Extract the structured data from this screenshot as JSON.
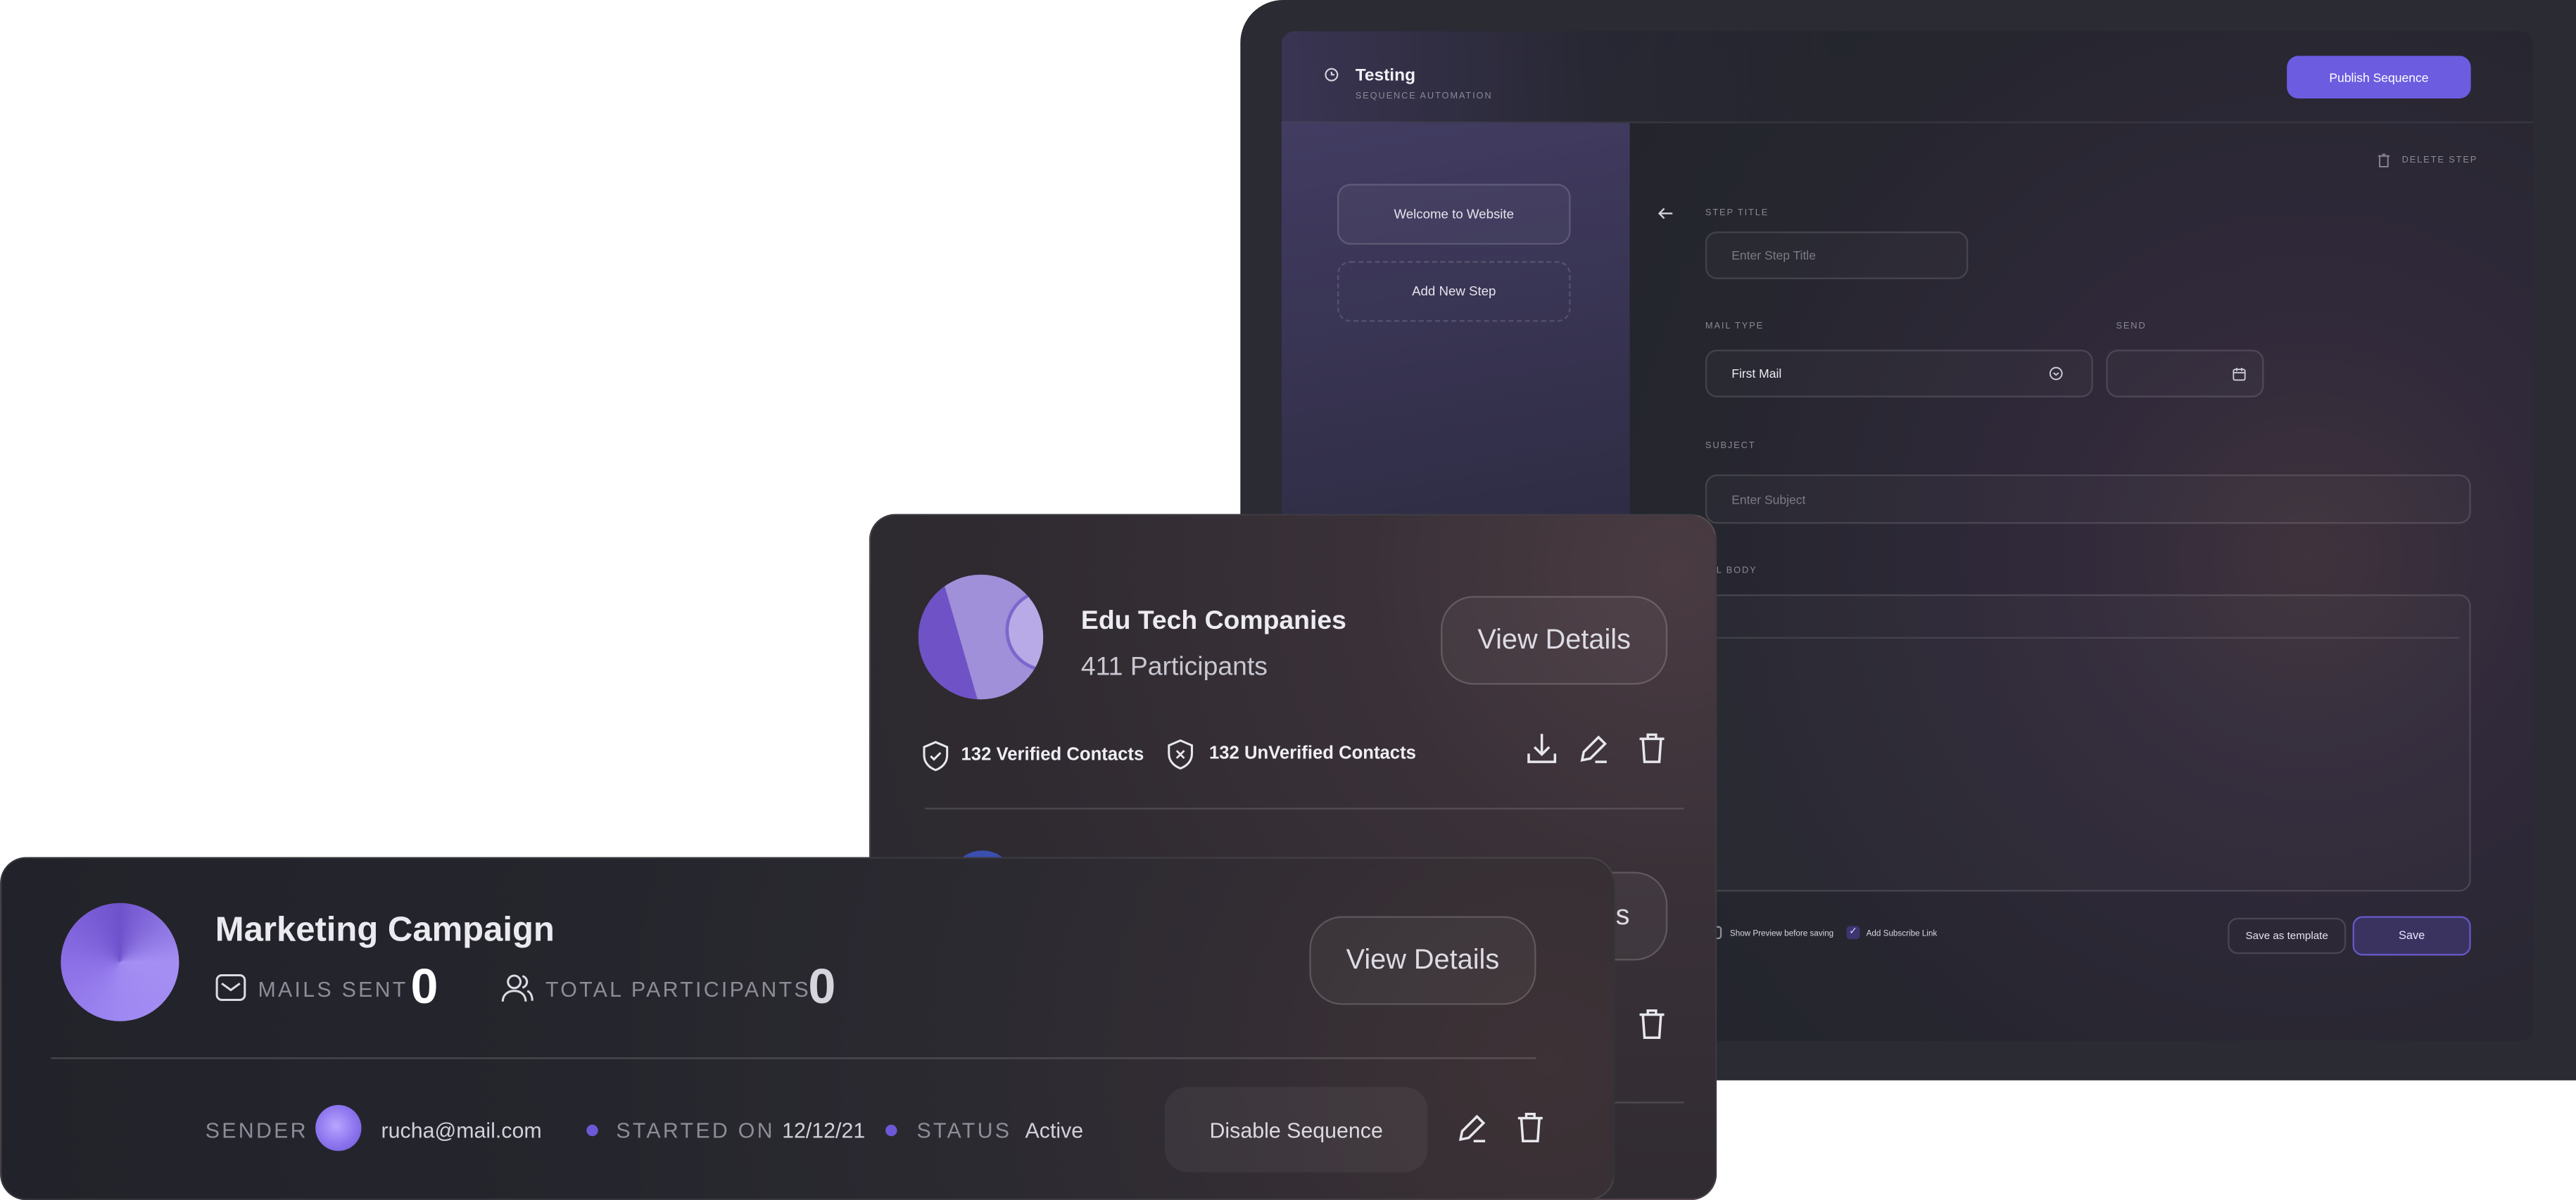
{
  "sequence_editor": {
    "title": "Testing",
    "subtitle": "SEQUENCE AUTOMATION",
    "publish_label": "Publish Sequence",
    "delete_step_label": "DELETE STEP",
    "steps": [
      "Welcome to Website",
      "Add New Step"
    ],
    "step_title": {
      "label": "STEP TITLE",
      "placeholder": "Enter Step Title"
    },
    "mail_type": {
      "label": "MAIL TYPE",
      "value": "First Mail"
    },
    "send": {
      "label": "SEND",
      "value": ""
    },
    "subject": {
      "label": "SUBJECT",
      "placeholder": "Enter Subject"
    },
    "mail_body": {
      "label": "AIL BODY"
    },
    "options": [
      {
        "label": "Show Preview before saving",
        "checked": false
      },
      {
        "label": "Add Subscribe Link",
        "checked": true
      }
    ],
    "save_template_label": "Save as template",
    "save_label": "Save",
    "accent": "#6c5ce0"
  },
  "contact_list_card": {
    "name": "Edu Tech Companies",
    "participants": "411 Participants",
    "view_details_label": "View Details",
    "verified": "132 Verified Contacts",
    "unverified": "132 UnVerified Contacts",
    "second_row_button_fragment": "s"
  },
  "campaign_card": {
    "name": "Marketing Campaign",
    "mails_sent_label": "MAILS SENT",
    "mails_sent_value": "0",
    "participants_label": "TOTAL PARTICIPANTS",
    "participants_value": "0",
    "view_details_label": "View Details",
    "sender_label": "SENDER",
    "sender_email": "rucha@mail.com",
    "started_label": "STARTED ON",
    "started_value": "12/12/21",
    "status_label": "STATUS",
    "status_value": "Active",
    "disable_label": "Disable Sequence",
    "dot_color": "#6d58d8"
  }
}
